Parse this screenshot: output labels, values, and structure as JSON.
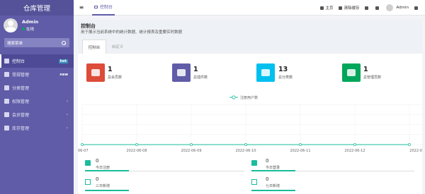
{
  "app": {
    "title": "仓库管理"
  },
  "user": {
    "name": "Admin",
    "status": "在线"
  },
  "search": {
    "placeholder": "搜索菜单"
  },
  "menu": [
    {
      "label": "控制台",
      "badge": "hot"
    },
    {
      "label": "常规管理",
      "badge": "new"
    },
    {
      "label": "分类管理"
    },
    {
      "label": "权限管理",
      "arrow": "‹"
    },
    {
      "label": "会员管理",
      "arrow": "‹"
    },
    {
      "label": "库存管理",
      "arrow": "‹"
    }
  ],
  "topbar": {
    "tab": "控制台",
    "home": "主页",
    "clear_cache": "清除缓存",
    "user": "Admin"
  },
  "page": {
    "title": "控制台",
    "subtitle": "用于展示当前系统中的统计数据、统计报表及重要实时数据",
    "tabs": [
      "控制台",
      "自定义"
    ]
  },
  "stats": [
    {
      "value": "1",
      "label": "总会员数",
      "color": "#dd4b39",
      "icon": "users-icon"
    },
    {
      "value": "1",
      "label": "总插件数",
      "color": "#605ca8",
      "icon": "magic-icon"
    },
    {
      "value": "13",
      "label": "总分类数",
      "color": "#00c0ef",
      "icon": "leaf-icon"
    },
    {
      "value": "1",
      "label": "总管理员数",
      "color": "#00a65a",
      "icon": "user-icon"
    }
  ],
  "chart_data": {
    "type": "line",
    "legend": [
      "注册用户数"
    ],
    "categories": [
      "06-07",
      "2022-06-08",
      "2022-06-09",
      "2022-06-10",
      "2022-06-11",
      "2022-06-12",
      "2022-0"
    ],
    "series": [
      {
        "name": "注册用户数",
        "values": [
          0,
          0,
          0,
          0,
          0,
          0,
          0
        ]
      }
    ],
    "color": "#1abc9c"
  },
  "small_stats": [
    {
      "value": "0",
      "label": "今日注册",
      "icon": "rocket-icon"
    },
    {
      "value": "0",
      "label": "今日登录",
      "icon": "id-card-icon"
    },
    {
      "value": "0",
      "label": "三日新增",
      "icon": "calendar-icon"
    },
    {
      "value": "0",
      "label": "七日新增",
      "icon": "calendar-plus-icon"
    }
  ]
}
